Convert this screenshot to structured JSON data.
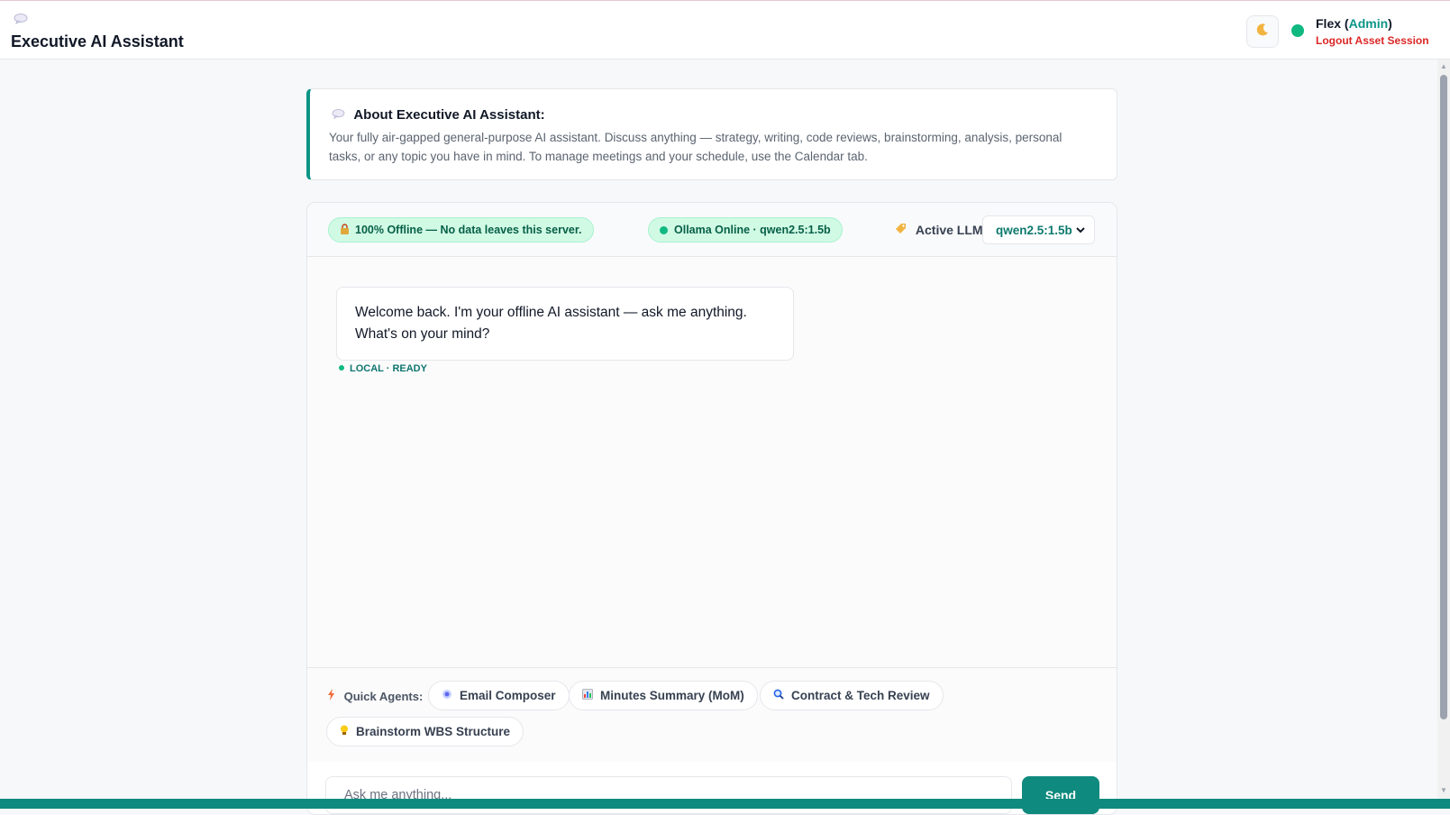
{
  "header": {
    "brand_icon": "speech-bubble-icon",
    "title": "Executive AI Assistant",
    "theme_icon": "moon-icon",
    "user": {
      "name": "Flex",
      "role_open": " (",
      "role": "Admin",
      "role_close": ")",
      "logout_label": "Logout Asset Session"
    }
  },
  "about": {
    "icon": "speech-bubble-icon",
    "heading": "About Executive AI Assistant:",
    "text": "Your fully air-gapped general-purpose AI assistant. Discuss anything — strategy, writing, code reviews, brainstorming, analysis, personal tasks, or any topic you have in mind. To manage meetings and your schedule, use the Calendar tab."
  },
  "status": {
    "offline_badge": "100% Offline — No data leaves this server.",
    "ollama_badge": "Ollama Online · qwen2.5:1.5b",
    "active_llm_label": "Active LLM:",
    "selected_model": "qwen2.5:1.5b"
  },
  "chat": {
    "messages": [
      {
        "text": "Welcome back. I'm your offline AI assistant — ask me anything. What's on your mind?",
        "status": "LOCAL · READY"
      }
    ]
  },
  "quick_agents": {
    "label": "Quick Agents:",
    "items": [
      {
        "icon": "email-icon",
        "label": "Email Composer"
      },
      {
        "icon": "bar-chart-icon",
        "label": "Minutes Summary (MoM)"
      },
      {
        "icon": "magnifier-icon",
        "label": "Contract & Tech Review"
      },
      {
        "icon": "lightbulb-icon",
        "label": "Brainstorm WBS Structure"
      }
    ]
  },
  "composer": {
    "placeholder": "Ask me anything...",
    "send_label": "Send"
  },
  "colors": {
    "accent": "#0f8a7e",
    "online": "#10b981",
    "logout": "#dc2626"
  }
}
